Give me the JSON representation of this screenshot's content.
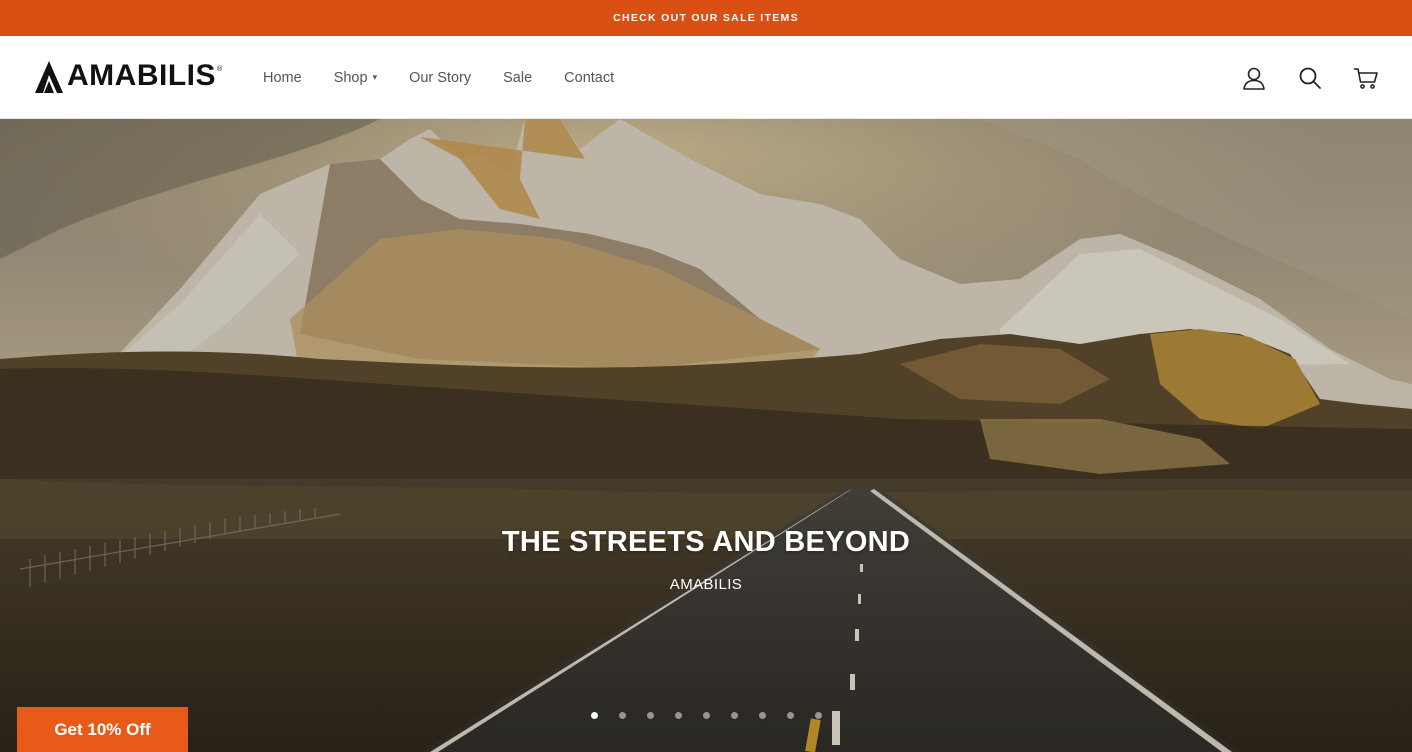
{
  "announcement": {
    "text": "CHECK OUT OUR SALE ITEMS"
  },
  "brand": {
    "name": "AMABILIS",
    "registered": "®"
  },
  "nav": {
    "items": [
      {
        "label": "Home"
      },
      {
        "label": "Shop",
        "caret": "▾"
      },
      {
        "label": "Our Story"
      },
      {
        "label": "Sale"
      },
      {
        "label": "Contact"
      }
    ]
  },
  "header_icons": [
    "account-icon",
    "search-icon",
    "cart-icon"
  ],
  "hero": {
    "title": "THE STREETS AND BEYOND",
    "subtitle": "AMABILIS",
    "slide_count": 9,
    "active_slide": 1
  },
  "promo": {
    "label": "Get 10% Off"
  },
  "colors": {
    "accent": "#d94f14",
    "promo": "#e85a1a",
    "nav_text": "#555555",
    "logo": "#111111"
  }
}
